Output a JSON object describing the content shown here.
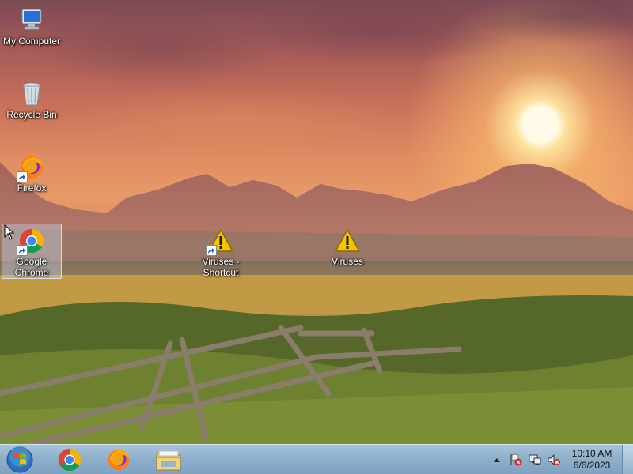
{
  "desktop": {
    "icons": [
      {
        "label": "My Computer",
        "icon": "computer-icon"
      },
      {
        "label": "Recycle Bin",
        "icon": "recycle-bin-icon"
      },
      {
        "label": "Firefox",
        "icon": "firefox-icon"
      },
      {
        "label": "Google Chrome",
        "icon": "chrome-icon"
      },
      {
        "label": "Viruses - Shortcut",
        "icon": "warning-icon"
      },
      {
        "label": "Viruses",
        "icon": "warning-icon"
      }
    ]
  },
  "taskbar": {
    "pinned": [
      {
        "name": "chrome-icon"
      },
      {
        "name": "firefox-icon"
      },
      {
        "name": "file-explorer-icon"
      }
    ],
    "tray": {
      "icons": [
        "show-hidden-icons-arrow",
        "action-center-flag-icon",
        "network-icon",
        "volume-muted-icon"
      ],
      "time": "10:10 AM",
      "date": "6/6/2023"
    }
  },
  "colors": {
    "taskbar": "#8fb0cc",
    "selection": "#c8d7f0",
    "warning": "#f4c400"
  }
}
